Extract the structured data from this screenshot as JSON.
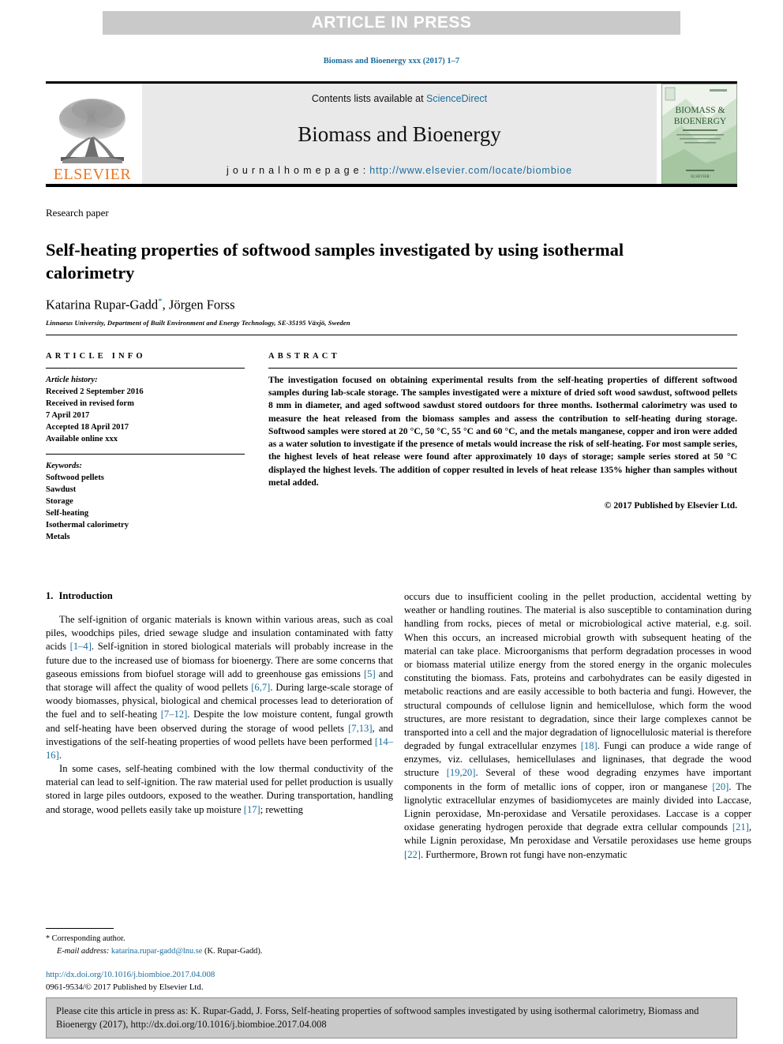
{
  "banner": {
    "label": "ARTICLE IN PRESS"
  },
  "running_head": "Biomass and Bioenergy xxx (2017) 1–7",
  "masthead": {
    "publisher_name": "ELSEVIER",
    "contents_prefix": "Contents lists available at ",
    "contents_link": "ScienceDirect",
    "journal_name": "Biomass and Bioenergy",
    "homepage_prefix": "j o u r n a l   h o m e p a g e :  ",
    "homepage_url": "http://www.elsevier.com/locate/biombioe",
    "cover": {
      "title_line1": "BIOMASS &",
      "title_line2": "BIOENERGY",
      "sub_line1": "",
      "publisher": "ELSEVIER"
    }
  },
  "article": {
    "type_label": "Research paper",
    "title": "Self-heating properties of softwood samples investigated by using isothermal calorimetry",
    "authors": "Katarina Rupar-Gadd",
    "authors_rest": ", Jörgen Forss",
    "corresponding_marker": "*",
    "affiliation": "Linnaeus University, Department of Built Environment and Energy Technology, SE-35195 Växjö, Sweden"
  },
  "article_info": {
    "heading": "ARTICLE INFO",
    "history_label": "Article history:",
    "history": [
      "Received 2 September 2016",
      "Received in revised form",
      "7 April 2017",
      "Accepted 18 April 2017",
      "Available online xxx"
    ],
    "keywords_label": "Keywords:",
    "keywords": [
      "Softwood pellets",
      "Sawdust",
      "Storage",
      "Self-heating",
      "Isothermal calorimetry",
      "Metals"
    ]
  },
  "abstract": {
    "heading": "ABSTRACT",
    "body": "The investigation focused on obtaining experimental results from the self-heating properties of different softwood samples during lab-scale storage. The samples investigated were a mixture of dried soft wood sawdust, softwood pellets 8 mm in diameter, and aged softwood sawdust stored outdoors for three months. Isothermal calorimetry was used to measure the heat released from the biomass samples and assess the contribution to self-heating during storage. Softwood samples were stored at 20 °C, 50 °C, 55 °C and 60 °C, and the metals manganese, copper and iron were added as a water solution to investigate if the presence of metals would increase the risk of self-heating. For most sample series, the highest levels of heat release were found after approximately 10 days of storage; sample series stored at 50 °C displayed the highest levels. The addition of copper resulted in levels of heat release 135% higher than samples without metal added.",
    "copyright": "© 2017 Published by Elsevier Ltd."
  },
  "introduction": {
    "number": "1.",
    "title": "Introduction",
    "left_paragraphs": [
      {
        "segments": [
          {
            "t": "The self-ignition of organic materials is known within various areas, such as coal piles, woodchips piles, dried sewage sludge and insulation contaminated with fatty acids "
          },
          {
            "t": "[1–4]",
            "ref": true
          },
          {
            "t": ". Self-ignition in stored biological materials will probably increase in the future due to the increased use of biomass for bioenergy. There are some concerns that gaseous emissions from biofuel storage will add to greenhouse gas emissions "
          },
          {
            "t": "[5]",
            "ref": true
          },
          {
            "t": " and that storage will affect the quality of wood pellets "
          },
          {
            "t": "[6,7]",
            "ref": true
          },
          {
            "t": ". During large-scale storage of woody biomasses, physical, biological and chemical processes lead to deterioration of the fuel and to self-heating "
          },
          {
            "t": "[7–12]",
            "ref": true
          },
          {
            "t": ". Despite the low moisture content, fungal growth and self-heating have been observed during the storage of wood pellets "
          },
          {
            "t": "[7,13]",
            "ref": true
          },
          {
            "t": ", and investigations of the self-heating properties of wood pellets have been performed "
          },
          {
            "t": "[14–16]",
            "ref": true
          },
          {
            "t": "."
          }
        ]
      },
      {
        "segments": [
          {
            "t": "In some cases, self-heating combined with the low thermal conductivity of the material can lead to self-ignition. The raw material used for pellet production is usually stored in large piles outdoors, exposed to the weather. During transportation, handling and storage, wood pellets easily take up moisture "
          },
          {
            "t": "[17]",
            "ref": true
          },
          {
            "t": "; rewetting"
          }
        ]
      }
    ],
    "right_paragraphs": [
      {
        "segments": [
          {
            "t": "occurs due to insufficient cooling in the pellet production, accidental wetting by weather or handling routines. The material is also susceptible to contamination during handling from rocks, pieces of metal or microbiological active material, e.g. soil. When this occurs, an increased microbial growth with subsequent heating of the material can take place. Microorganisms that perform degradation processes in wood or biomass material utilize energy from the stored energy in the organic molecules constituting the biomass. Fats, proteins and carbohydrates can be easily digested in metabolic reactions and are easily accessible to both bacteria and fungi. However, the structural compounds of cellulose lignin and hemicellulose, which form the wood structures, are more resistant to degradation, since their large complexes cannot be transported into a cell and the major degradation of lignocellulosic material is therefore degraded by fungal extracellular enzymes "
          },
          {
            "t": "[18]",
            "ref": true
          },
          {
            "t": ". Fungi can produce a wide range of enzymes, viz. cellulases, hemicellulases and ligninases, that degrade the wood structure "
          },
          {
            "t": "[19,20]",
            "ref": true
          },
          {
            "t": ". Several of these wood degrading enzymes have important components in the form of metallic ions of copper, iron or manganese "
          },
          {
            "t": "[20]",
            "ref": true
          },
          {
            "t": ". The lignolytic extracellular enzymes of basidiomycetes are mainly divided into Laccase, Lignin peroxidase, Mn-peroxidase and Versatile peroxidases. Laccase is a copper oxidase generating hydrogen peroxide that degrade extra cellular compounds "
          },
          {
            "t": "[21]",
            "ref": true
          },
          {
            "t": ", while Lignin peroxidase, Mn peroxidase and Versatile peroxidases use heme groups "
          },
          {
            "t": "[22]",
            "ref": true
          },
          {
            "t": ". Furthermore, Brown rot fungi have non-enzymatic"
          }
        ]
      }
    ]
  },
  "footnote": {
    "corresponding": "Corresponding author.",
    "email_label": "E-mail address:",
    "email": "katarina.rupar-gadd@lnu.se",
    "email_owner": "(K. Rupar-Gadd)."
  },
  "doi_block": {
    "doi": "http://dx.doi.org/10.1016/j.biombioe.2017.04.008",
    "issn_line": "0961-9534/© 2017 Published by Elsevier Ltd."
  },
  "citation_box": {
    "text": "Please cite this article in press as: K. Rupar-Gadd, J. Forss, Self-heating properties of softwood samples investigated by using isothermal calorimetry, Biomass and Bioenergy (2017), http://dx.doi.org/10.1016/j.biombioe.2017.04.008"
  },
  "colors": {
    "link": "#1a6c9c",
    "banner_bg": "#c9c9c9",
    "band_bg": "#e9e9e9",
    "elsevier_orange": "#e87722"
  }
}
